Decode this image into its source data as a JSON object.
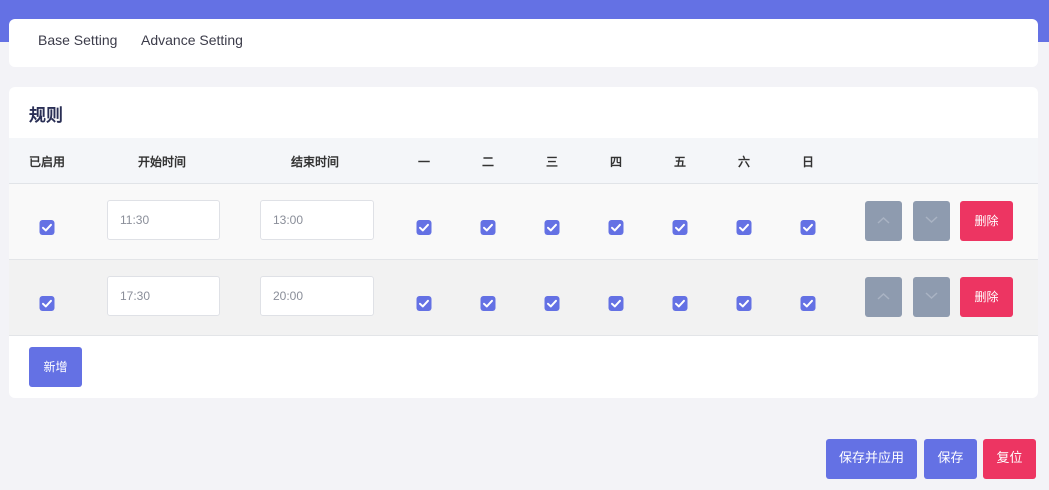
{
  "tabs": [
    {
      "label": "Base Setting"
    },
    {
      "label": "Advance Setting"
    }
  ],
  "rules": {
    "title": "规则",
    "columns": {
      "enabled": "已启用",
      "start": "开始时间",
      "end": "结束时间",
      "days": [
        "一",
        "二",
        "三",
        "四",
        "五",
        "六",
        "日"
      ]
    },
    "rows": [
      {
        "enabled": true,
        "start_time": "11:30",
        "end_time": "13:00",
        "days": [
          true,
          true,
          true,
          true,
          true,
          true,
          true
        ],
        "delete_label": "删除"
      },
      {
        "enabled": true,
        "start_time": "17:30",
        "end_time": "20:00",
        "days": [
          true,
          true,
          true,
          true,
          true,
          true,
          true
        ],
        "delete_label": "删除"
      }
    ],
    "add_label": "新增"
  },
  "footer": {
    "save_apply_label": "保存并应用",
    "save_label": "保存",
    "reset_label": "复位"
  },
  "colors": {
    "accent": "#6471e4",
    "danger": "#ed3562",
    "muted_button": "#8e9baf"
  }
}
